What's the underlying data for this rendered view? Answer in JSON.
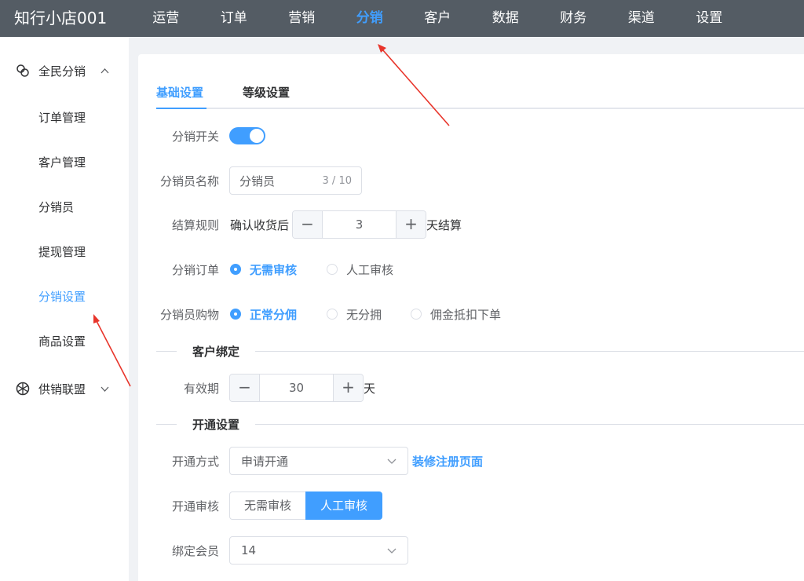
{
  "header": {
    "brand": "知行小店001",
    "nav": [
      "运营",
      "订单",
      "营销",
      "分销",
      "客户",
      "数据",
      "财务",
      "渠道",
      "设置"
    ],
    "active_nav": "分销"
  },
  "sidebar": {
    "group1": {
      "label": "全民分销",
      "icon": "distribution-icon"
    },
    "items": [
      "订单管理",
      "客户管理",
      "分销员",
      "提现管理",
      "分销设置",
      "商品设置"
    ],
    "active_item": "分销设置",
    "group2": {
      "label": "供销联盟",
      "icon": "network-icon"
    }
  },
  "tabs": {
    "basic": "基础设置",
    "level": "等级设置"
  },
  "form": {
    "switch_label": "分销开关",
    "name_label": "分销员名称",
    "name_value": "分销员",
    "name_count": "3 / 10",
    "settle_label": "结算规则",
    "settle_prefix": "确认收货后",
    "settle_days": "3",
    "settle_suffix": "天结算",
    "order_label": "分销订单",
    "order_opt1": "无需审核",
    "order_opt2": "人工审核",
    "buy_label": "分销员购物",
    "buy_opt1": "正常分佣",
    "buy_opt2": "无分拥",
    "buy_opt3": "佣金抵扣下单",
    "section_bind": "客户绑定",
    "valid_label": "有效期",
    "valid_value": "30",
    "valid_unit": "天",
    "section_open": "开通设置",
    "open_mode_label": "开通方式",
    "open_mode_value": "申请开通",
    "open_mode_link": "装修注册页面",
    "open_review_label": "开通审核",
    "open_review_opt1": "无需审核",
    "open_review_opt2": "人工审核",
    "bind_member_label": "绑定会员",
    "bind_member_value": "14"
  },
  "stepper_symbols": {
    "minus": "−",
    "plus": "+"
  },
  "colors": {
    "primary": "#409eff",
    "topbar": "#545c64",
    "annotation": "#e8352b"
  }
}
